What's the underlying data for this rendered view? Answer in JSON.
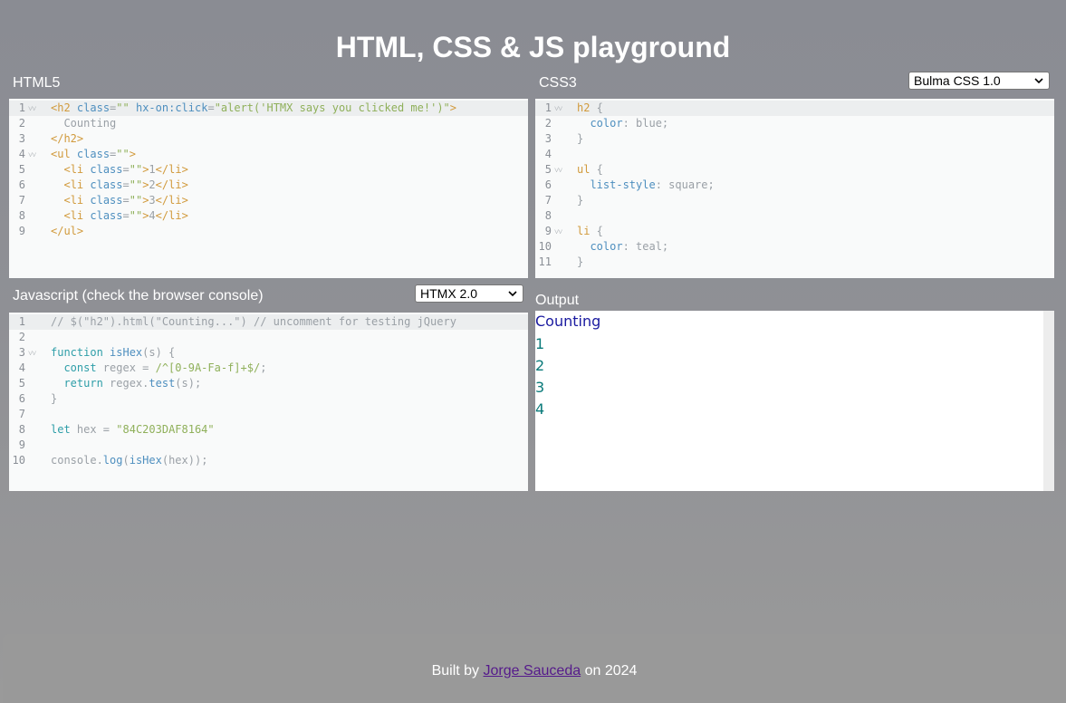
{
  "page": {
    "title": "HTML, CSS & JS playground"
  },
  "html_panel": {
    "label": "HTML5",
    "lines": [
      {
        "n": "1",
        "fold": true,
        "segs": [
          {
            "t": "<",
            "c": "tag"
          },
          {
            "t": "h2",
            "c": "tag"
          },
          {
            "t": " ",
            "c": "plain"
          },
          {
            "t": "class",
            "c": "attr"
          },
          {
            "t": "=",
            "c": "plain"
          },
          {
            "t": "\"\"",
            "c": "str"
          },
          {
            "t": " ",
            "c": "plain"
          },
          {
            "t": "hx-on:click",
            "c": "attr"
          },
          {
            "t": "=",
            "c": "plain"
          },
          {
            "t": "\"alert('HTMX says you clicked me!')\"",
            "c": "str"
          },
          {
            "t": ">",
            "c": "tag"
          }
        ]
      },
      {
        "n": "2",
        "fold": false,
        "segs": [
          {
            "t": "  Counting",
            "c": "plain"
          }
        ]
      },
      {
        "n": "3",
        "fold": false,
        "segs": [
          {
            "t": "</",
            "c": "tag"
          },
          {
            "t": "h2",
            "c": "tag"
          },
          {
            "t": ">",
            "c": "tag"
          }
        ]
      },
      {
        "n": "4",
        "fold": true,
        "segs": [
          {
            "t": "<",
            "c": "tag"
          },
          {
            "t": "ul",
            "c": "tag"
          },
          {
            "t": " ",
            "c": "plain"
          },
          {
            "t": "class",
            "c": "attr"
          },
          {
            "t": "=",
            "c": "plain"
          },
          {
            "t": "\"\"",
            "c": "str"
          },
          {
            "t": ">",
            "c": "tag"
          }
        ]
      },
      {
        "n": "5",
        "fold": false,
        "segs": [
          {
            "t": "  <",
            "c": "tag"
          },
          {
            "t": "li",
            "c": "tag"
          },
          {
            "t": " ",
            "c": "plain"
          },
          {
            "t": "class",
            "c": "attr"
          },
          {
            "t": "=",
            "c": "plain"
          },
          {
            "t": "\"\"",
            "c": "str"
          },
          {
            "t": ">",
            "c": "tag"
          },
          {
            "t": "1",
            "c": "plain"
          },
          {
            "t": "</",
            "c": "tag"
          },
          {
            "t": "li",
            "c": "tag"
          },
          {
            "t": ">",
            "c": "tag"
          }
        ]
      },
      {
        "n": "6",
        "fold": false,
        "segs": [
          {
            "t": "  <",
            "c": "tag"
          },
          {
            "t": "li",
            "c": "tag"
          },
          {
            "t": " ",
            "c": "plain"
          },
          {
            "t": "class",
            "c": "attr"
          },
          {
            "t": "=",
            "c": "plain"
          },
          {
            "t": "\"\"",
            "c": "str"
          },
          {
            "t": ">",
            "c": "tag"
          },
          {
            "t": "2",
            "c": "plain"
          },
          {
            "t": "</",
            "c": "tag"
          },
          {
            "t": "li",
            "c": "tag"
          },
          {
            "t": ">",
            "c": "tag"
          }
        ]
      },
      {
        "n": "7",
        "fold": false,
        "segs": [
          {
            "t": "  <",
            "c": "tag"
          },
          {
            "t": "li",
            "c": "tag"
          },
          {
            "t": " ",
            "c": "plain"
          },
          {
            "t": "class",
            "c": "attr"
          },
          {
            "t": "=",
            "c": "plain"
          },
          {
            "t": "\"\"",
            "c": "str"
          },
          {
            "t": ">",
            "c": "tag"
          },
          {
            "t": "3",
            "c": "plain"
          },
          {
            "t": "</",
            "c": "tag"
          },
          {
            "t": "li",
            "c": "tag"
          },
          {
            "t": ">",
            "c": "tag"
          }
        ]
      },
      {
        "n": "8",
        "fold": false,
        "segs": [
          {
            "t": "  <",
            "c": "tag"
          },
          {
            "t": "li",
            "c": "tag"
          },
          {
            "t": " ",
            "c": "plain"
          },
          {
            "t": "class",
            "c": "attr"
          },
          {
            "t": "=",
            "c": "plain"
          },
          {
            "t": "\"\"",
            "c": "str"
          },
          {
            "t": ">",
            "c": "tag"
          },
          {
            "t": "4",
            "c": "plain"
          },
          {
            "t": "</",
            "c": "tag"
          },
          {
            "t": "li",
            "c": "tag"
          },
          {
            "t": ">",
            "c": "tag"
          }
        ]
      },
      {
        "n": "9",
        "fold": false,
        "segs": [
          {
            "t": "</",
            "c": "tag"
          },
          {
            "t": "ul",
            "c": "tag"
          },
          {
            "t": ">",
            "c": "tag"
          }
        ]
      }
    ]
  },
  "css_panel": {
    "label": "CSS3",
    "framework_select": "Bulma CSS 1.0",
    "lines": [
      {
        "n": "1",
        "fold": true,
        "segs": [
          {
            "t": "h2",
            "c": "tag"
          },
          {
            "t": " {",
            "c": "plain"
          }
        ]
      },
      {
        "n": "2",
        "fold": false,
        "segs": [
          {
            "t": "  ",
            "c": "plain"
          },
          {
            "t": "color",
            "c": "prop"
          },
          {
            "t": ": blue;",
            "c": "plain"
          }
        ]
      },
      {
        "n": "3",
        "fold": false,
        "segs": [
          {
            "t": "}",
            "c": "plain"
          }
        ]
      },
      {
        "n": "4",
        "fold": false,
        "segs": []
      },
      {
        "n": "5",
        "fold": true,
        "segs": [
          {
            "t": "ul",
            "c": "tag"
          },
          {
            "t": " {",
            "c": "plain"
          }
        ]
      },
      {
        "n": "6",
        "fold": false,
        "segs": [
          {
            "t": "  ",
            "c": "plain"
          },
          {
            "t": "list-style",
            "c": "prop"
          },
          {
            "t": ": square;",
            "c": "plain"
          }
        ]
      },
      {
        "n": "7",
        "fold": false,
        "segs": [
          {
            "t": "}",
            "c": "plain"
          }
        ]
      },
      {
        "n": "8",
        "fold": false,
        "segs": []
      },
      {
        "n": "9",
        "fold": true,
        "segs": [
          {
            "t": "li",
            "c": "tag"
          },
          {
            "t": " {",
            "c": "plain"
          }
        ]
      },
      {
        "n": "10",
        "fold": false,
        "segs": [
          {
            "t": "  ",
            "c": "plain"
          },
          {
            "t": "color",
            "c": "prop"
          },
          {
            "t": ": teal;",
            "c": "plain"
          }
        ]
      },
      {
        "n": "11",
        "fold": false,
        "segs": [
          {
            "t": "}",
            "c": "plain"
          }
        ]
      }
    ]
  },
  "js_panel": {
    "label": "Javascript (check the browser console)",
    "library_select": "HTMX 2.0",
    "lines": [
      {
        "n": "1",
        "fold": false,
        "segs": [
          {
            "t": "// $(\"h2\").html(\"Counting...\") // uncomment for testing jQuery",
            "c": "plain"
          }
        ]
      },
      {
        "n": "2",
        "fold": false,
        "segs": []
      },
      {
        "n": "3",
        "fold": true,
        "segs": [
          {
            "t": "function",
            "c": "kw"
          },
          {
            "t": " ",
            "c": "plain"
          },
          {
            "t": "isHex",
            "c": "prop"
          },
          {
            "t": "(s) {",
            "c": "plain"
          }
        ]
      },
      {
        "n": "4",
        "fold": false,
        "segs": [
          {
            "t": "  ",
            "c": "plain"
          },
          {
            "t": "const",
            "c": "kw"
          },
          {
            "t": " regex = ",
            "c": "plain"
          },
          {
            "t": "/^[0-9A-Fa-f]+$/",
            "c": "str"
          },
          {
            "t": ";",
            "c": "plain"
          }
        ]
      },
      {
        "n": "5",
        "fold": false,
        "segs": [
          {
            "t": "  ",
            "c": "plain"
          },
          {
            "t": "return",
            "c": "kw"
          },
          {
            "t": " regex.",
            "c": "plain"
          },
          {
            "t": "test",
            "c": "prop"
          },
          {
            "t": "(s);",
            "c": "plain"
          }
        ]
      },
      {
        "n": "6",
        "fold": false,
        "segs": [
          {
            "t": "}",
            "c": "plain"
          }
        ]
      },
      {
        "n": "7",
        "fold": false,
        "segs": []
      },
      {
        "n": "8",
        "fold": false,
        "segs": [
          {
            "t": "let",
            "c": "kw"
          },
          {
            "t": " hex = ",
            "c": "plain"
          },
          {
            "t": "\"84C203DAF8164\"",
            "c": "str"
          }
        ]
      },
      {
        "n": "9",
        "fold": false,
        "segs": []
      },
      {
        "n": "10",
        "fold": false,
        "segs": [
          {
            "t": "console.",
            "c": "plain"
          },
          {
            "t": "log",
            "c": "prop"
          },
          {
            "t": "(",
            "c": "plain"
          },
          {
            "t": "isHex",
            "c": "prop"
          },
          {
            "t": "(hex));",
            "c": "plain"
          }
        ]
      }
    ]
  },
  "output_panel": {
    "label": "Output",
    "heading": "Counting",
    "items": [
      "1",
      "2",
      "3",
      "4"
    ]
  },
  "footer": {
    "prefix": "Built by",
    "author": "Jorge Sauceda",
    "suffix": "on 2024"
  },
  "colors": {
    "heading_blue": "#1a1aa0",
    "list_teal": "#0a7a7a",
    "link_purple": "#551a8b",
    "footer_bg": "#999999"
  },
  "icons": {
    "fold": "chevron-down-icon",
    "select": "chevron-down-icon"
  }
}
